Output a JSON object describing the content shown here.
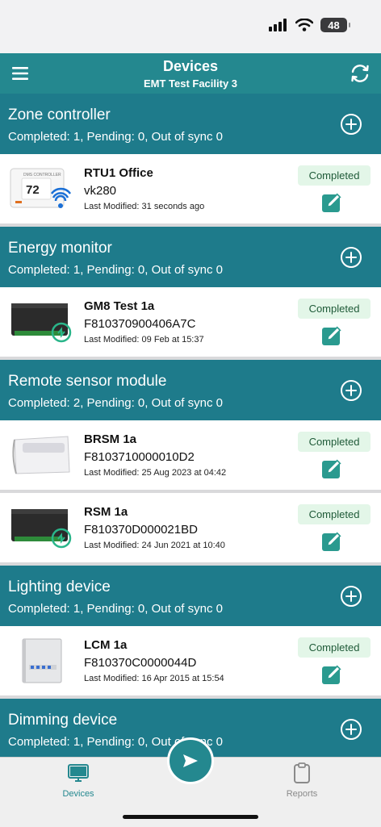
{
  "status_bar": {
    "battery": "48"
  },
  "nav": {
    "title": "Devices",
    "subtitle": "EMT Test Facility 3"
  },
  "colors": {
    "primary": "#24888f",
    "section": "#1e7b8b",
    "completed_bg": "#e3f6e8",
    "completed_text": "#1f5a38"
  },
  "sections": [
    {
      "title": "Zone controller",
      "summary": "Completed: 1, Pending: 0, Out of sync 0",
      "devices": [
        {
          "name": "RTU1 Office",
          "id": "vk280",
          "modified": "Last Modified: 31 seconds ago",
          "status": "Completed",
          "image": "thermostat-wifi",
          "thermostat_header": "DMS CONTROLLER",
          "thermostat_temp": "72"
        }
      ]
    },
    {
      "title": "Energy monitor",
      "summary": "Completed: 1, Pending: 0, Out of sync 0",
      "devices": [
        {
          "name": "GM8 Test 1a",
          "id": "F810370900406A7C",
          "modified": "Last Modified: 09 Feb at 15:37",
          "status": "Completed",
          "image": "black-module"
        }
      ]
    },
    {
      "title": "Remote sensor module",
      "summary": "Completed: 2, Pending: 0, Out of sync 0",
      "devices": [
        {
          "name": "BRSM 1a",
          "id": "F8103710000010D2",
          "modified": "Last Modified: 25 Aug 2023 at 04:42",
          "status": "Completed",
          "image": "white-sensor"
        },
        {
          "name": "RSM 1a",
          "id": "F810370D000021BD",
          "modified": "Last Modified: 24 Jun 2021 at 10:40",
          "status": "Completed",
          "image": "black-module"
        }
      ]
    },
    {
      "title": "Lighting device",
      "summary": "Completed: 1, Pending: 0, Out of sync 0",
      "devices": [
        {
          "name": "LCM 1a",
          "id": "F810370C0000044D",
          "modified": "Last Modified: 16 Apr 2015 at 15:54",
          "status": "Completed",
          "image": "panel-box"
        }
      ]
    },
    {
      "title": "Dimming device",
      "summary": "Completed: 1, Pending: 0, Out of sync 0",
      "devices": []
    }
  ],
  "tabs": [
    {
      "label": "Devices",
      "icon": "monitor-icon",
      "active": true
    },
    {
      "label": "Reports",
      "icon": "clipboard-icon",
      "active": false
    }
  ],
  "fab": {
    "icon": "send-icon"
  }
}
